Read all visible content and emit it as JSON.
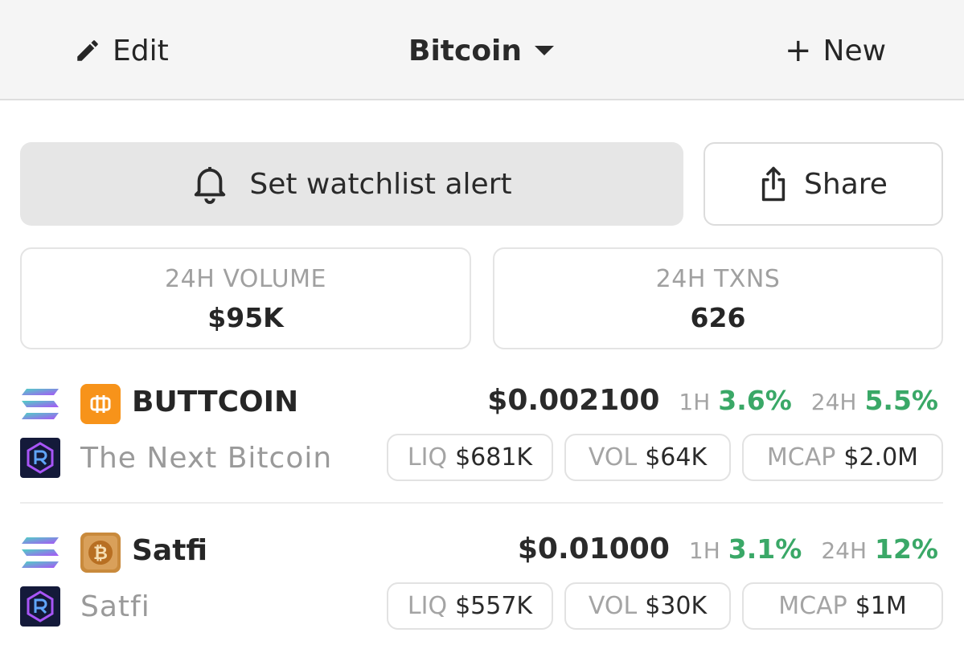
{
  "header": {
    "edit_label": "Edit",
    "title": "Bitcoin",
    "new_label": "New"
  },
  "actions": {
    "alert_label": "Set watchlist alert",
    "share_label": "Share"
  },
  "stats": [
    {
      "label": "24H VOLUME",
      "value": "$95K"
    },
    {
      "label": "24H TXNS",
      "value": "626"
    }
  ],
  "tokens": [
    {
      "symbol": "BUTTCOIN",
      "name": "The Next Bitcoin",
      "price": "$0.002100",
      "change_1h_label": "1H",
      "change_1h": "3.6%",
      "change_24h_label": "24H",
      "change_24h": "5.5%",
      "liq_label": "LIQ",
      "liq": "$681K",
      "vol_label": "VOL",
      "vol": "$64K",
      "mcap_label": "MCAP",
      "mcap": "$2.0M"
    },
    {
      "symbol": "Satfi",
      "name": "Satfi",
      "price": "$0.01000",
      "change_1h_label": "1H",
      "change_1h": "3.1%",
      "change_24h_label": "24H",
      "change_24h": "12%",
      "liq_label": "LIQ",
      "liq": "$557K",
      "vol_label": "VOL",
      "vol": "$30K",
      "mcap_label": "MCAP",
      "mcap": "$1M"
    }
  ],
  "colors": {
    "positive": "#3aa867",
    "header_bg": "#f5f5f5",
    "alert_bg": "#e6e6e6",
    "muted_text": "#a0a0a0"
  },
  "icons": [
    "pencil-icon",
    "caret-down-icon",
    "plus-icon",
    "bell-icon",
    "share-icon",
    "solana-chain-icon",
    "raydium-dex-icon",
    "buttcoin-logo",
    "satfi-logo"
  ]
}
